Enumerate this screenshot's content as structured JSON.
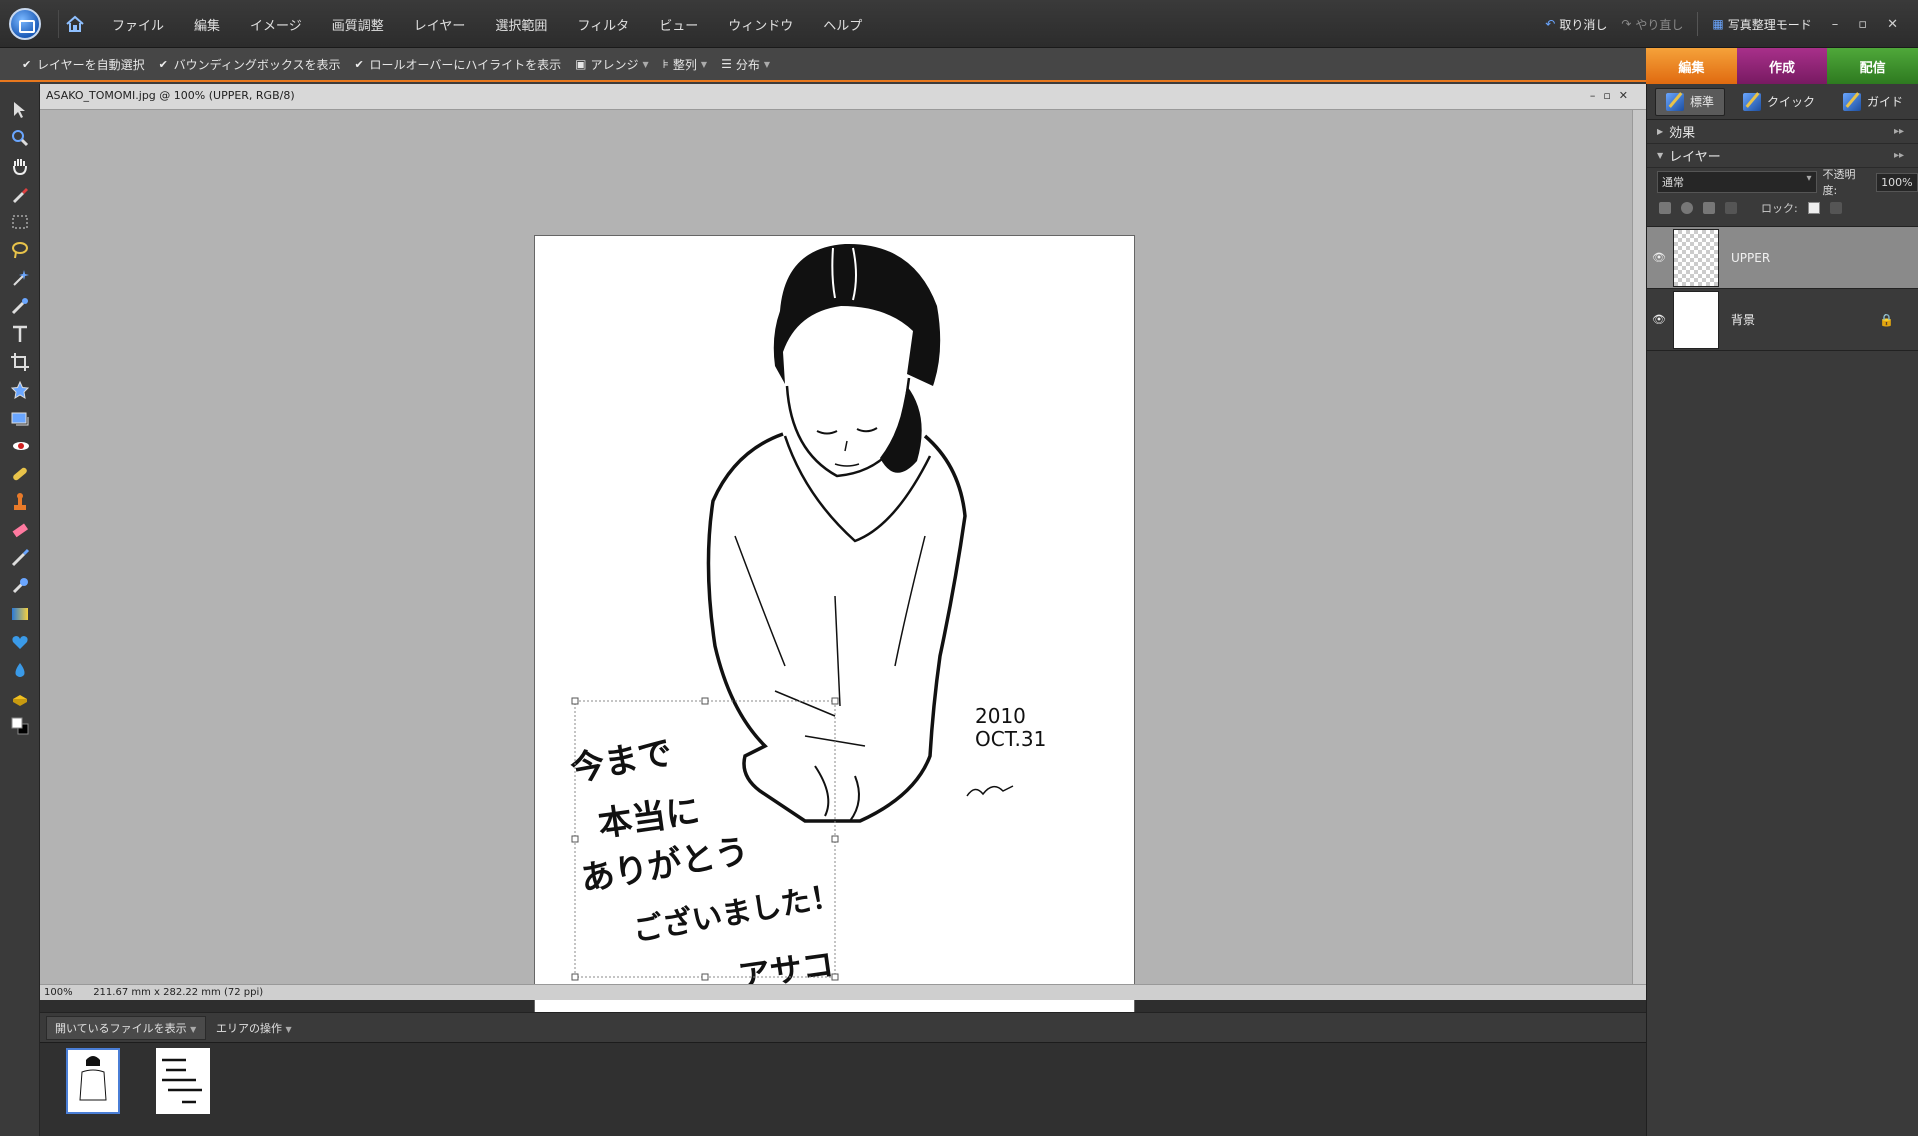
{
  "menubar": {
    "items": [
      "ファイル",
      "編集",
      "イメージ",
      "画質調整",
      "レイヤー",
      "選択範囲",
      "フィルタ",
      "ビュー",
      "ウィンドウ",
      "ヘルプ"
    ],
    "undo": "取り消し",
    "redo": "やり直し",
    "organizer": "写真整理モード"
  },
  "options": {
    "auto_select": "レイヤーを自動選択",
    "bounding_box": "バウンディングボックスを表示",
    "rollover": "ロールオーバーにハイライトを表示",
    "arrange": "アレンジ",
    "align": "整列",
    "distribute": "分布"
  },
  "mode_tabs": {
    "edit": "編集",
    "create": "作成",
    "share": "配信"
  },
  "document": {
    "title": "ASAKO_TOMOMI.jpg @ 100% (UPPER, RGB/8)",
    "zoom": "100%",
    "dimensions": "211.67 mm x 282.22 mm (72 ppi)"
  },
  "artwork": {
    "message_lines": [
      "今まで",
      "本当に",
      "ありがとう",
      "ございました！",
      "アサコ"
    ],
    "date_lines": [
      "2010",
      "OCT.31"
    ]
  },
  "bin": {
    "show_files": "開いているファイルを表示",
    "area_ops": "エリアの操作"
  },
  "panel": {
    "subtabs": [
      "標準",
      "クイック",
      "ガイド"
    ],
    "effects": "効果",
    "layers_title": "レイヤー",
    "blend_mode": "通常",
    "opacity_label": "不透明度:",
    "opacity_value": "100%",
    "lock_label": "ロック:",
    "layers": [
      {
        "name": "UPPER",
        "selected": true
      },
      {
        "name": "背景",
        "locked": true
      }
    ]
  },
  "colors": {
    "accent_orange": "#e8781e",
    "tab_create": "#a8308a",
    "tab_share": "#4fa83a"
  }
}
